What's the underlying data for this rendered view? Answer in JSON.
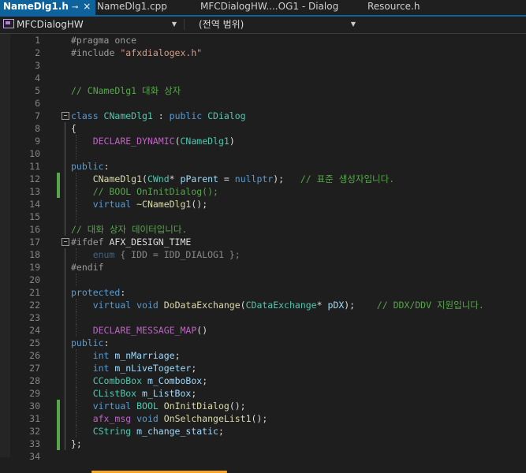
{
  "tabs": [
    {
      "label": "NameDlg1.h",
      "pin": "⊸",
      "close": "×"
    },
    {
      "label": "NameDlg1.cpp"
    },
    {
      "label": "MFCDialogHW....OG1 - Dialog"
    },
    {
      "label": "Resource.h"
    }
  ],
  "nav": {
    "project": "MFCDialogHW",
    "scope": "(전역 범위)"
  },
  "colors": {
    "accent": "#0e639c",
    "keyword": "#569cd6",
    "type": "#4ec9b0",
    "comment": "#57a64a",
    "string": "#d69d85",
    "change_marker": "#57a64a",
    "highlight_underline": "#f5a623"
  },
  "lines": [
    {
      "n": "1",
      "tokens": [
        [
          "pp",
          "#pragma once"
        ]
      ]
    },
    {
      "n": "2",
      "tokens": [
        [
          "pp",
          "#include "
        ],
        [
          "str",
          "\"afxdialogex.h\""
        ]
      ]
    },
    {
      "n": "3",
      "tokens": []
    },
    {
      "n": "4",
      "tokens": []
    },
    {
      "n": "5",
      "tokens": [
        [
          "cm",
          "// CNameDlg1 대화 상자"
        ]
      ]
    },
    {
      "n": "6",
      "tokens": []
    },
    {
      "n": "7",
      "fold": true,
      "tokens": [
        [
          "kw",
          "class "
        ],
        [
          "cls",
          "CNameDlg1"
        ],
        [
          "txt",
          " : "
        ],
        [
          "kw",
          "public "
        ],
        [
          "cls",
          "CDialog"
        ]
      ]
    },
    {
      "n": "8",
      "tokens": [
        [
          "txt",
          "{"
        ]
      ]
    },
    {
      "n": "9",
      "tokens": [
        [
          "txt",
          "    "
        ],
        [
          "mac",
          "DECLARE_DYNAMIC"
        ],
        [
          "txt",
          "("
        ],
        [
          "cls",
          "CNameDlg1"
        ],
        [
          "txt",
          ")"
        ]
      ]
    },
    {
      "n": "10",
      "tokens": []
    },
    {
      "n": "11",
      "tokens": [
        [
          "kw",
          "public"
        ],
        [
          "txt",
          ":"
        ]
      ]
    },
    {
      "n": "12",
      "changed": true,
      "tokens": [
        [
          "txt",
          "    "
        ],
        [
          "fn",
          "CNameDlg1"
        ],
        [
          "txt",
          "("
        ],
        [
          "cls",
          "CWnd"
        ],
        [
          "txt",
          "* "
        ],
        [
          "var",
          "pParent"
        ],
        [
          "txt",
          " = "
        ],
        [
          "kw",
          "nullptr"
        ],
        [
          "txt",
          ");   "
        ],
        [
          "cm",
          "// 표준 생성자입니다."
        ]
      ]
    },
    {
      "n": "13",
      "changed": true,
      "tokens": [
        [
          "txt",
          "    "
        ],
        [
          "cm",
          "// BOOL OnInitDialog();"
        ]
      ]
    },
    {
      "n": "14",
      "tokens": [
        [
          "txt",
          "    "
        ],
        [
          "kw",
          "virtual "
        ],
        [
          "fn",
          "~CNameDlg1"
        ],
        [
          "txt",
          "();"
        ]
      ]
    },
    {
      "n": "15",
      "tokens": []
    },
    {
      "n": "16",
      "tokens": [
        [
          "cm",
          "// 대화 상자 데이터입니다."
        ]
      ]
    },
    {
      "n": "17",
      "fold": true,
      "tokens": [
        [
          "pp",
          "#ifdef "
        ],
        [
          "txt",
          "AFX_DESIGN_TIME"
        ]
      ]
    },
    {
      "n": "18",
      "tokens": [
        [
          "txt",
          "    "
        ],
        [
          "kwdim",
          "enum"
        ],
        [
          "dim",
          " { IDD = IDD_DIALOG1 };"
        ]
      ]
    },
    {
      "n": "19",
      "tokens": [
        [
          "pp",
          "#endif"
        ]
      ]
    },
    {
      "n": "20",
      "tokens": []
    },
    {
      "n": "21",
      "tokens": [
        [
          "kw",
          "protected"
        ],
        [
          "txt",
          ":"
        ]
      ]
    },
    {
      "n": "22",
      "tokens": [
        [
          "txt",
          "    "
        ],
        [
          "kw",
          "virtual void "
        ],
        [
          "fn",
          "DoDataExchange"
        ],
        [
          "txt",
          "("
        ],
        [
          "cls",
          "CDataExchange"
        ],
        [
          "txt",
          "* "
        ],
        [
          "var",
          "pDX"
        ],
        [
          "txt",
          ");    "
        ],
        [
          "cm",
          "// DDX/DDV 지원입니다."
        ]
      ]
    },
    {
      "n": "23",
      "tokens": []
    },
    {
      "n": "24",
      "tokens": [
        [
          "txt",
          "    "
        ],
        [
          "mac",
          "DECLARE_MESSAGE_MAP"
        ],
        [
          "txt",
          "()"
        ]
      ]
    },
    {
      "n": "25",
      "tokens": [
        [
          "kw",
          "public"
        ],
        [
          "txt",
          ":"
        ]
      ]
    },
    {
      "n": "26",
      "tokens": [
        [
          "txt",
          "    "
        ],
        [
          "kw",
          "int "
        ],
        [
          "var",
          "m_nMarriage"
        ],
        [
          "txt",
          ";"
        ]
      ]
    },
    {
      "n": "27",
      "tokens": [
        [
          "txt",
          "    "
        ],
        [
          "kw",
          "int "
        ],
        [
          "var",
          "m_nLiveTogeter"
        ],
        [
          "txt",
          ";"
        ]
      ]
    },
    {
      "n": "28",
      "tokens": [
        [
          "txt",
          "    "
        ],
        [
          "cls",
          "CComboBox "
        ],
        [
          "var",
          "m_ComboBox"
        ],
        [
          "txt",
          ";"
        ]
      ]
    },
    {
      "n": "29",
      "tokens": [
        [
          "txt",
          "    "
        ],
        [
          "cls",
          "CListBox "
        ],
        [
          "var",
          "m_ListBox"
        ],
        [
          "txt",
          ";"
        ]
      ]
    },
    {
      "n": "30",
      "changed": true,
      "tokens": [
        [
          "txt",
          "    "
        ],
        [
          "kw",
          "virtual "
        ],
        [
          "cls",
          "BOOL "
        ],
        [
          "fn",
          "OnInitDialog"
        ],
        [
          "txt",
          "();"
        ]
      ]
    },
    {
      "n": "31",
      "changed": true,
      "tokens": [
        [
          "txt",
          "    "
        ],
        [
          "mac",
          "afx_msg "
        ],
        [
          "kw",
          "void "
        ],
        [
          "fn",
          "OnSelchangeList1"
        ],
        [
          "txt",
          "();"
        ]
      ]
    },
    {
      "n": "32",
      "changed": true,
      "tokens": [
        [
          "txt",
          "    "
        ],
        [
          "cls",
          "CString "
        ],
        [
          "var",
          "m_change_static"
        ],
        [
          "txt",
          ";"
        ]
      ]
    },
    {
      "n": "33",
      "changed": true,
      "tokens": [
        [
          "txt",
          "};"
        ]
      ]
    },
    {
      "n": "34",
      "tokens": []
    }
  ]
}
